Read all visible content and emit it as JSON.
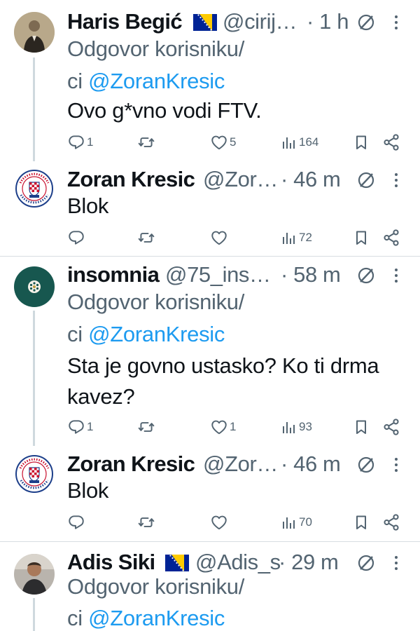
{
  "reply_to_label": "Odgovor korisniku/",
  "reply_to_suffix": "ci ",
  "colors": {
    "link": "#1d9bf0",
    "secondary": "#536471",
    "text": "#0f1419"
  },
  "tweets": [
    {
      "name": "Haris Begić",
      "flag": "bosnia-flag",
      "handle": "@cirij…",
      "time": "· 1 h",
      "reply_to": "@ZoranKresic",
      "text": "Ovo g*vno vodi FTV.",
      "counts": {
        "replies": "1",
        "likes": "5",
        "views": "164"
      }
    },
    {
      "name": "Zoran Kresic",
      "handle": "@Zor…",
      "time": "· 46 m",
      "text": "Blok",
      "counts": {
        "views": "72"
      }
    },
    {
      "name": "insomnia",
      "handle": "@75_ins…",
      "time": "· 58 m",
      "reply_to": "@ZoranKresic",
      "text_lines": [
        "Sta je govno ustasko? Ko ti drma",
        "kavez?"
      ],
      "counts": {
        "replies": "1",
        "likes": "1",
        "views": "93"
      }
    },
    {
      "name": "Zoran Kresic",
      "handle": "@Zor…",
      "time": "· 46 m",
      "text": "Blok",
      "counts": {
        "views": "70"
      }
    },
    {
      "name": "Adis Siki",
      "flag": "bosnia-flag",
      "handle": "@Adis_s",
      "time": "· 29 m",
      "reply_to": "@ZoranKresic"
    }
  ]
}
